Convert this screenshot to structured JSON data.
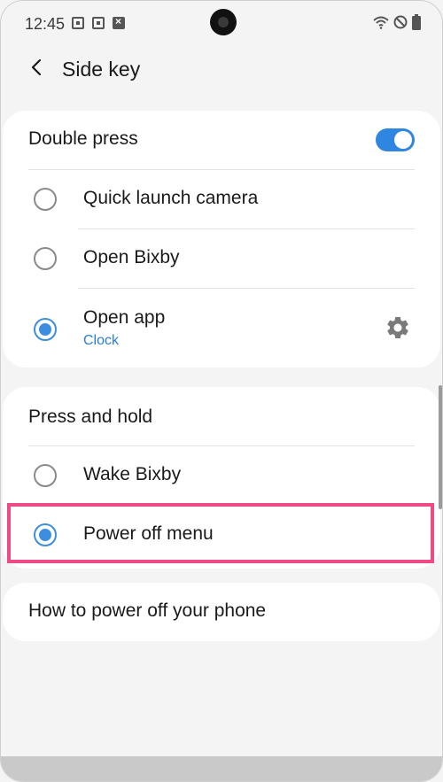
{
  "status_bar": {
    "time": "12:45",
    "left_icons": [
      "screenshot-icon",
      "screen-record-icon",
      "notification-x-icon"
    ],
    "right_icons": [
      "wifi-icon",
      "do-not-disturb-icon",
      "battery-icon"
    ]
  },
  "header": {
    "title": "Side key",
    "back_icon": "chevron-left-icon"
  },
  "double_press": {
    "header": "Double press",
    "toggle_on": true,
    "options": [
      {
        "label": "Quick launch camera",
        "selected": false
      },
      {
        "label": "Open Bixby",
        "selected": false
      },
      {
        "label": "Open app",
        "sub": "Clock",
        "selected": true
      }
    ]
  },
  "press_and_hold": {
    "header": "Press and hold",
    "options": [
      {
        "label": "Wake Bixby",
        "selected": false
      },
      {
        "label": "Power off menu",
        "selected": true
      }
    ]
  },
  "howto": {
    "label": "How to power off your phone"
  },
  "colors": {
    "accent": "#2f86e1",
    "highlight": "#ee4a86",
    "background": "#f4f4f4",
    "card": "#ffffff"
  }
}
